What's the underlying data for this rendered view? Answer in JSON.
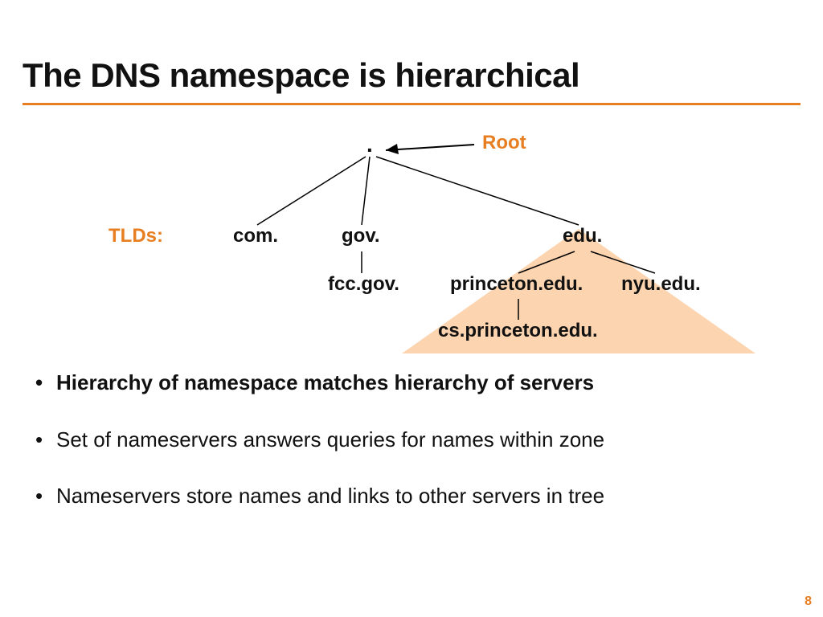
{
  "title": "The DNS namespace is hierarchical",
  "labels": {
    "root": "Root",
    "tlds": "TLDs:"
  },
  "nodes": {
    "root_dot": ".",
    "com": "com.",
    "gov": "gov.",
    "edu": "edu.",
    "fcc": "fcc.gov.",
    "princeton": "princeton.edu.",
    "nyu": "nyu.edu.",
    "cs_princeton": "cs.princeton.edu."
  },
  "bullets": [
    "Hierarchy of namespace matches hierarchy of servers",
    "Set of nameservers answers queries for names within zone",
    "Nameservers store names and links to other servers in tree"
  ],
  "page_number": "8"
}
